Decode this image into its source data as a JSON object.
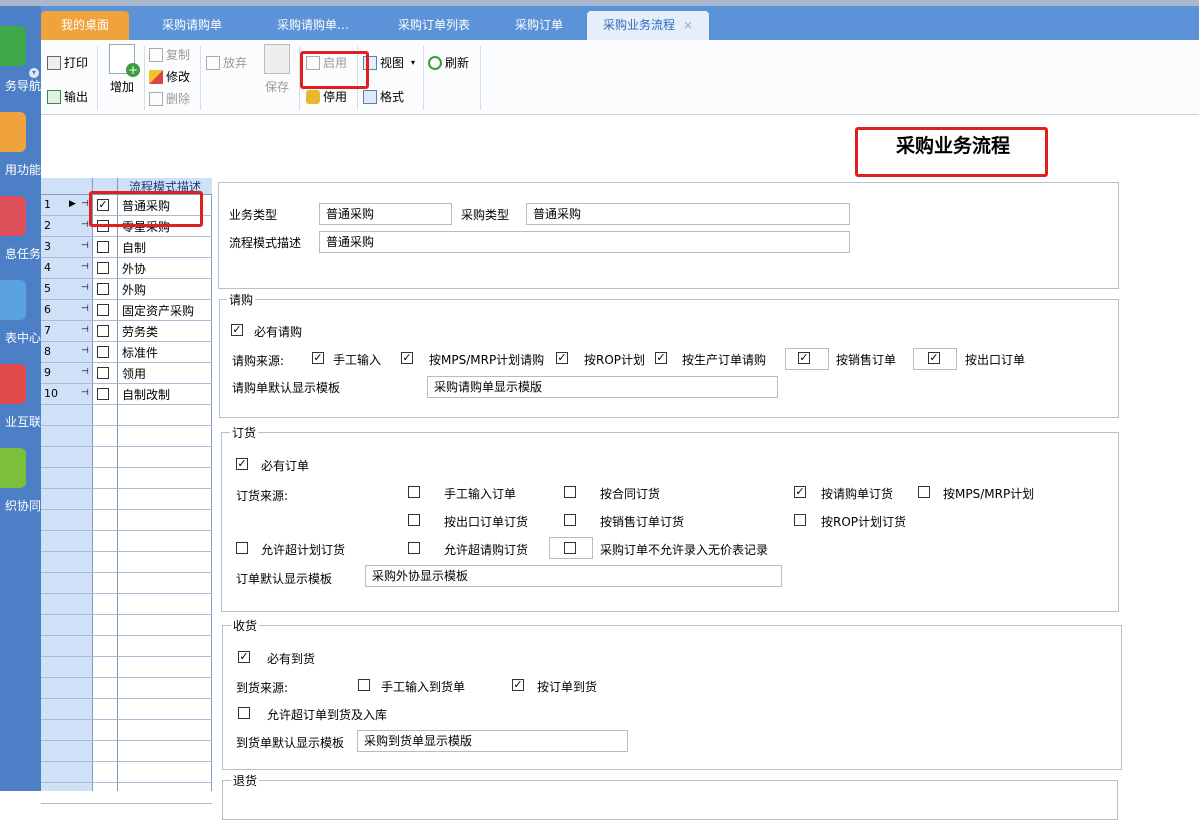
{
  "nav": {
    "items": [
      {
        "label": "务导航",
        "color": "#3ea84a"
      },
      {
        "label": "用功能",
        "color": "#f0a23c"
      },
      {
        "label": "息任务",
        "color": "#e0505a"
      },
      {
        "label": "表中心",
        "color": "#5aa2e0"
      },
      {
        "label": "业互联",
        "color": "#e04a4a"
      },
      {
        "label": "织协同",
        "color": "#7cbf3a"
      }
    ]
  },
  "tabs": [
    {
      "label": "我的桌面"
    },
    {
      "label": "采购请购单"
    },
    {
      "label": "采购请购单…"
    },
    {
      "label": "采购订单列表"
    },
    {
      "label": "采购订单"
    },
    {
      "label": "采购业务流程",
      "close": "×"
    }
  ],
  "toolbar": {
    "print": "打印",
    "export": "输出",
    "add": "增加",
    "copy": "复制",
    "edit": "修改",
    "delete": "删除",
    "discard": "放弃",
    "save": "保存",
    "enable": "启用",
    "disable": "停用",
    "view": "视图",
    "format": "格式",
    "refresh": "刷新"
  },
  "page_title": "采购业务流程",
  "grid": {
    "header": "流程模式描述",
    "rows": [
      {
        "num": "1",
        "text": "普通采购",
        "checked": true
      },
      {
        "num": "2",
        "text": "零星采购",
        "checked": false
      },
      {
        "num": "3",
        "text": "自制",
        "checked": false
      },
      {
        "num": "4",
        "text": "外协",
        "checked": false
      },
      {
        "num": "5",
        "text": "外购",
        "checked": false
      },
      {
        "num": "6",
        "text": "固定资产采购",
        "checked": false
      },
      {
        "num": "7",
        "text": "劳务类",
        "checked": false
      },
      {
        "num": "8",
        "text": "标准件",
        "checked": false
      },
      {
        "num": "9",
        "text": "领用",
        "checked": false
      },
      {
        "num": "10",
        "text": "自制改制",
        "checked": false
      }
    ]
  },
  "form": {
    "biz_type_label": "业务类型",
    "biz_type": "普通采购",
    "purchase_type_label": "采购类型",
    "purchase_type": "普通采购",
    "mode_desc_label": "流程模式描述",
    "mode_desc": "普通采购",
    "requisition": {
      "legend": "请购",
      "required": "必有请购",
      "source_label": "请购来源:",
      "manual": "手工输入",
      "mps": "按MPS/MRP计划请购",
      "rop": "按ROP计划",
      "prod": "按生产订单请购",
      "sales": "按销售订单",
      "export": "按出口订单",
      "template_label": "请购单默认显示模板",
      "template": "采购请购单显示模版"
    },
    "order": {
      "legend": "订货",
      "required": "必有订单",
      "source_label": "订货来源:",
      "manual": "手工输入订单",
      "contract": "按合同订货",
      "req": "按请购单订货",
      "mps": "按MPS/MRP计划",
      "export": "按出口订单订货",
      "sales": "按销售订单订货",
      "rop": "按ROP计划订货",
      "over_plan": "允许超计划订货",
      "over_req": "允许超请购订货",
      "no_price": "采购订单不允许录入无价表记录",
      "template_label": "订单默认显示模板",
      "template": "采购外协显示模板"
    },
    "receipt": {
      "legend": "收货",
      "required": "必有到货",
      "source_label": "到货来源:",
      "manual": "手工输入到货单",
      "by_order": "按订单到货",
      "over": "允许超订单到货及入库",
      "template_label": "到货单默认显示模板",
      "template": "采购到货单显示模版"
    },
    "return": {
      "legend": "退货"
    }
  },
  "colors": {
    "accent": "#e02020",
    "tab_bar": "#5c92d8",
    "nav": "#4d7fc6",
    "home_tab": "#f0a23c"
  }
}
